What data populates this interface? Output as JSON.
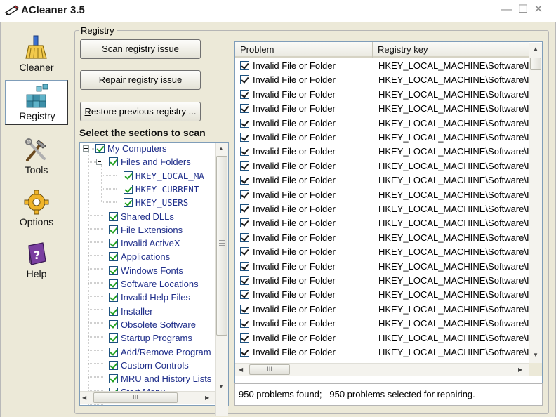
{
  "window": {
    "title": "ACleaner 3.5",
    "minimize": "—",
    "maximize": "☐",
    "close": "✕"
  },
  "nav": {
    "items": [
      {
        "label": "Cleaner",
        "icon": "broom-icon"
      },
      {
        "label": "Registry",
        "icon": "registry-cubes-icon"
      },
      {
        "label": "Tools",
        "icon": "tools-icon"
      },
      {
        "label": "Options",
        "icon": "gear-icon"
      },
      {
        "label": "Help",
        "icon": "help-book-icon"
      }
    ],
    "active": "Registry"
  },
  "registry": {
    "group_title": "Registry",
    "scan_button": {
      "accel": "S",
      "rest": "can registry issue"
    },
    "repair_button": {
      "accel": "R",
      "rest": "epair registry issue"
    },
    "restore_button": {
      "accel": "R",
      "rest": "estore previous registry ..."
    },
    "sections_heading": "Select the sections to scan",
    "tree": [
      {
        "label": "My Computers",
        "level": 0,
        "expander": true,
        "checked": true
      },
      {
        "label": "Files and Folders",
        "level": 1,
        "expander": true,
        "checked": true
      },
      {
        "label": "HKEY_LOCAL_MA",
        "level": 2,
        "checked": true,
        "mono": true
      },
      {
        "label": "HKEY_CURRENT",
        "level": 2,
        "checked": true,
        "mono": true
      },
      {
        "label": "HKEY_USERS",
        "level": 2,
        "checked": true,
        "mono": true
      },
      {
        "label": "Shared DLLs",
        "level": 1,
        "checked": true
      },
      {
        "label": "File Extensions",
        "level": 1,
        "checked": true
      },
      {
        "label": "Invalid ActiveX",
        "level": 1,
        "checked": true
      },
      {
        "label": "Applications",
        "level": 1,
        "checked": true
      },
      {
        "label": "Windows Fonts",
        "level": 1,
        "checked": true
      },
      {
        "label": "Software Locations",
        "level": 1,
        "checked": true
      },
      {
        "label": "Invalid Help Files",
        "level": 1,
        "checked": true
      },
      {
        "label": "Installer",
        "level": 1,
        "checked": true
      },
      {
        "label": "Obsolete Software",
        "level": 1,
        "checked": true
      },
      {
        "label": "Startup Programs",
        "level": 1,
        "checked": true
      },
      {
        "label": "Add/Remove Program",
        "level": 1,
        "checked": true
      },
      {
        "label": "Custom Controls",
        "level": 1,
        "checked": true
      },
      {
        "label": "MRU and History Lists",
        "level": 1,
        "checked": true
      },
      {
        "label": "Start Menu",
        "level": 1,
        "checked": true
      }
    ],
    "results": {
      "columns": [
        "Problem",
        "Registry key"
      ],
      "rows": [
        {
          "problem": "Invalid File or Folder",
          "key": "HKEY_LOCAL_MACHINE\\Software\\I",
          "checked": true
        },
        {
          "problem": "Invalid File or Folder",
          "key": "HKEY_LOCAL_MACHINE\\Software\\I",
          "checked": true
        },
        {
          "problem": "Invalid File or Folder",
          "key": "HKEY_LOCAL_MACHINE\\Software\\I",
          "checked": true
        },
        {
          "problem": "Invalid File or Folder",
          "key": "HKEY_LOCAL_MACHINE\\Software\\I",
          "checked": true
        },
        {
          "problem": "Invalid File or Folder",
          "key": "HKEY_LOCAL_MACHINE\\Software\\I",
          "checked": true
        },
        {
          "problem": "Invalid File or Folder",
          "key": "HKEY_LOCAL_MACHINE\\Software\\I",
          "checked": true
        },
        {
          "problem": "Invalid File or Folder",
          "key": "HKEY_LOCAL_MACHINE\\Software\\I",
          "checked": true
        },
        {
          "problem": "Invalid File or Folder",
          "key": "HKEY_LOCAL_MACHINE\\Software\\I",
          "checked": true
        },
        {
          "problem": "Invalid File or Folder",
          "key": "HKEY_LOCAL_MACHINE\\Software\\I",
          "checked": true
        },
        {
          "problem": "Invalid File or Folder",
          "key": "HKEY_LOCAL_MACHINE\\Software\\I",
          "checked": true
        },
        {
          "problem": "Invalid File or Folder",
          "key": "HKEY_LOCAL_MACHINE\\Software\\I",
          "checked": true
        },
        {
          "problem": "Invalid File or Folder",
          "key": "HKEY_LOCAL_MACHINE\\Software\\I",
          "checked": true
        },
        {
          "problem": "Invalid File or Folder",
          "key": "HKEY_LOCAL_MACHINE\\Software\\I",
          "checked": true
        },
        {
          "problem": "Invalid File or Folder",
          "key": "HKEY_LOCAL_MACHINE\\Software\\I",
          "checked": true
        },
        {
          "problem": "Invalid File or Folder",
          "key": "HKEY_LOCAL_MACHINE\\Software\\I",
          "checked": true
        },
        {
          "problem": "Invalid File or Folder",
          "key": "HKEY_LOCAL_MACHINE\\Software\\I",
          "checked": true
        },
        {
          "problem": "Invalid File or Folder",
          "key": "HKEY_LOCAL_MACHINE\\Software\\I",
          "checked": true
        },
        {
          "problem": "Invalid File or Folder",
          "key": "HKEY_LOCAL_MACHINE\\Software\\I",
          "checked": true
        },
        {
          "problem": "Invalid File or Folder",
          "key": "HKEY_LOCAL_MACHINE\\Software\\I",
          "checked": true
        },
        {
          "problem": "Invalid File or Folder",
          "key": "HKEY_LOCAL_MACHINE\\Software\\I",
          "checked": true
        },
        {
          "problem": "Invalid File or Folder",
          "key": "HKEY_LOCAL_MACHINE\\Software\\I",
          "checked": true
        }
      ]
    },
    "status": {
      "found": "950 problems found;",
      "selected": "950 problems selected for repairing."
    }
  },
  "scrollbar_grip": "III",
  "colors": {
    "window_bg": "#ece9d8",
    "tree_text": "#1f2e8a",
    "tree_check": "#21a121",
    "list_border": "#7f9db9"
  }
}
